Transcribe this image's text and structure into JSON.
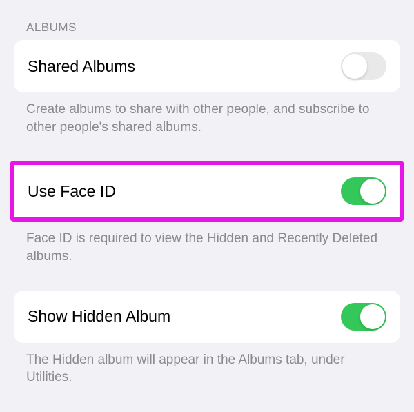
{
  "section": {
    "header": "ALBUMS"
  },
  "settings": [
    {
      "label": "Shared Albums",
      "description": "Create albums to share with other people, and subscribe to other people's shared albums.",
      "enabled": false,
      "highlighted": false
    },
    {
      "label": "Use Face ID",
      "description": "Face ID is required to view the Hidden and Recently Deleted albums.",
      "enabled": true,
      "highlighted": true
    },
    {
      "label": "Show Hidden Album",
      "description": "The Hidden album will appear in the Albums tab, under Utilities.",
      "enabled": true,
      "highlighted": false
    }
  ]
}
